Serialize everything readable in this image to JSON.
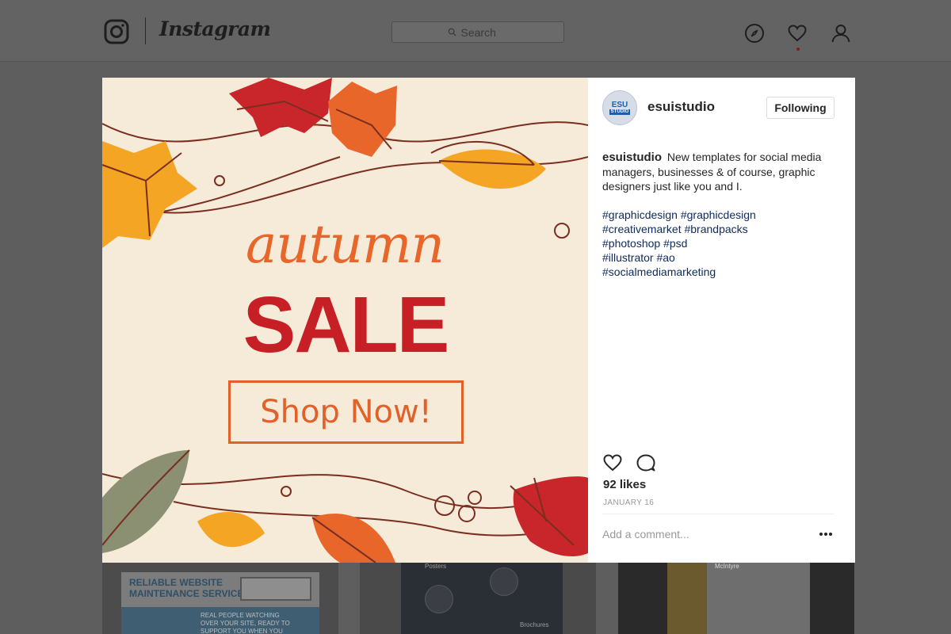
{
  "topbar": {
    "wordmark": "Instagram",
    "search_placeholder": "Search",
    "icons": [
      "instagram-camera-icon",
      "search-icon",
      "compass-icon",
      "heart-icon",
      "profile-icon"
    ]
  },
  "post": {
    "image_text": {
      "script_word": "autumn",
      "headline": "SALE",
      "cta": "Shop Now!"
    },
    "header": {
      "avatar_text": "ESU",
      "avatar_subtext": "STUDIO",
      "username": "esuistudio",
      "follow_label": "Following"
    },
    "caption": {
      "username": "esuistudio",
      "text": "New templates for social media managers, businesses & of course, graphic designers just like you and I.",
      "hashtag_lines": [
        "#graphicdesign #graphicdesign",
        "#creativemarket #brandpacks",
        "#photoshop #psd",
        "#illustrator #ao",
        "#socialmediamarketing"
      ]
    },
    "likes": "92 likes",
    "date": "JANUARY 16",
    "comment_placeholder": "Add a comment..."
  },
  "feed": {
    "thumb1": {
      "title_line1": "RELIABLE WEBSITE",
      "title_line2": "MAINTENANCE SERVICES",
      "note": "REAL PEOPLE WATCHING OVER YOUR SITE, READY TO SUPPORT YOU WHEN YOU NEED IT"
    },
    "thumb2": {
      "label_top": "Posters",
      "label_bottom": "Brochures"
    },
    "thumb3": {
      "name": "McIntyre"
    }
  },
  "colors": {
    "accent_orange": "#e8662a",
    "accent_red": "#c61f26",
    "cream": "#f6ebd9",
    "hashtag": "#0e2a5c"
  }
}
